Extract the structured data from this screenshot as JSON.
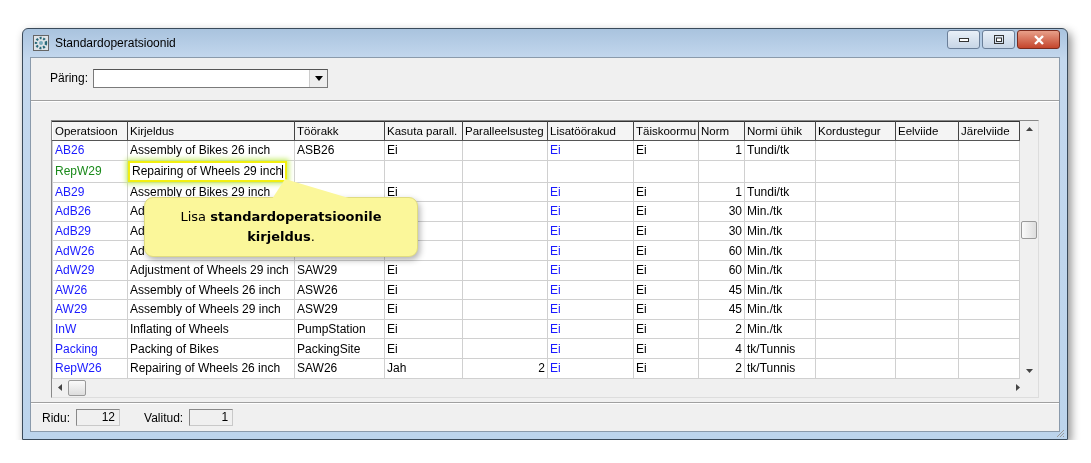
{
  "window": {
    "title": "Standardoperatsioonid"
  },
  "query": {
    "label": "Päring:"
  },
  "table": {
    "columns": [
      {
        "label": "Operatsioon",
        "kind": "code"
      },
      {
        "label": "Kirjeldus",
        "kind": "description"
      },
      {
        "label": "Töörakk",
        "kind": "text"
      },
      {
        "label": "Kasuta parall.",
        "kind": "text"
      },
      {
        "label": "Paralleelsusteg",
        "kind": "number"
      },
      {
        "label": "Lisatöörakud",
        "kind": "link"
      },
      {
        "label": "Täiskoormu",
        "kind": "text"
      },
      {
        "label": "Norm",
        "kind": "number"
      },
      {
        "label": "Normi ühik",
        "kind": "text"
      },
      {
        "label": "Kordustegur",
        "kind": "text"
      },
      {
        "label": "Eelviide",
        "kind": "text"
      },
      {
        "label": "Järelviide",
        "kind": "text"
      }
    ],
    "rows": [
      {
        "color": "#1a1aff",
        "editing": false,
        "cells": [
          "AB26",
          "Assembly of Bikes 26 inch",
          "ASB26",
          "Ei",
          null,
          "Ei",
          "Ei",
          "1",
          "Tundi/tk",
          null,
          null,
          null
        ]
      },
      {
        "color": "#1a8a1a",
        "editing": true,
        "cells": [
          "RepW29",
          "Repairing of Wheels 29 inch",
          null,
          null,
          null,
          null,
          null,
          null,
          null,
          null,
          null,
          null
        ]
      },
      {
        "color": "#1a1aff",
        "editing": false,
        "cells": [
          "AB29",
          "Assembly of Bikes 29 inch",
          null,
          "Ei",
          null,
          "Ei",
          "Ei",
          "1",
          "Tundi/tk",
          null,
          null,
          null
        ]
      },
      {
        "color": "#1a1aff",
        "editing": false,
        "cells": [
          "AdB26",
          "Ad",
          null,
          null,
          null,
          "Ei",
          "Ei",
          "30",
          "Min./tk",
          null,
          null,
          null
        ]
      },
      {
        "color": "#1a1aff",
        "editing": false,
        "cells": [
          "AdB29",
          "Ad",
          null,
          null,
          null,
          "Ei",
          "Ei",
          "30",
          "Min./tk",
          null,
          null,
          null
        ]
      },
      {
        "color": "#1a1aff",
        "editing": false,
        "cells": [
          "AdW26",
          "Ad",
          null,
          null,
          null,
          "Ei",
          "Ei",
          "60",
          "Min./tk",
          null,
          null,
          null
        ]
      },
      {
        "color": "#1a1aff",
        "editing": false,
        "cells": [
          "AdW29",
          "Adjustment of Wheels 29 inch",
          "SAW29",
          "Ei",
          null,
          "Ei",
          "Ei",
          "60",
          "Min./tk",
          null,
          null,
          null
        ]
      },
      {
        "color": "#1a1aff",
        "editing": false,
        "cells": [
          "AW26",
          "Assembly of Wheels 26 inch",
          "ASW26",
          "Ei",
          null,
          "Ei",
          "Ei",
          "45",
          "Min./tk",
          null,
          null,
          null
        ]
      },
      {
        "color": "#1a1aff",
        "editing": false,
        "cells": [
          "AW29",
          "Assembly of Wheels 29 inch",
          "ASW29",
          "Ei",
          null,
          "Ei",
          "Ei",
          "45",
          "Min./tk",
          null,
          null,
          null
        ]
      },
      {
        "color": "#1a1aff",
        "editing": false,
        "cells": [
          "InW",
          "Inflating of Wheels",
          "PumpStation",
          "Ei",
          null,
          "Ei",
          "Ei",
          "2",
          "Min./tk",
          null,
          null,
          null
        ]
      },
      {
        "color": "#1a1aff",
        "editing": false,
        "cells": [
          "Packing",
          "Packing of Bikes",
          "PackingSite",
          "Ei",
          null,
          "Ei",
          "Ei",
          "4",
          "tk/Tunnis",
          null,
          null,
          null
        ]
      },
      {
        "color": "#1a1aff",
        "editing": false,
        "cells": [
          "RepW26",
          "Repairing of Wheels 26 inch",
          "SAW26",
          "Jah",
          "2",
          "Ei",
          "Ei",
          "2",
          "tk/Tunnis",
          null,
          null,
          null
        ]
      }
    ]
  },
  "callout": {
    "text": "Lisa **standardoperatsioonile kirjeldus**."
  },
  "status_bar": {
    "items": [
      {
        "label": "Ridu:",
        "value": "12"
      },
      {
        "label": "Valitud:",
        "value": "1"
      }
    ]
  }
}
